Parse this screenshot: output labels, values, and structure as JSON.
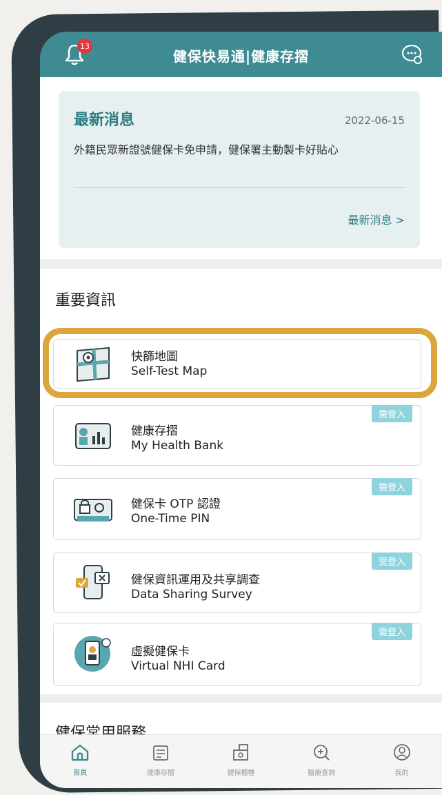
{
  "header": {
    "title": "健保快易通|健康存摺",
    "notification_count": "13",
    "bell_icon": "bell-icon",
    "chat_icon": "chat-bubble-icon"
  },
  "news": {
    "title": "最新消息",
    "date": "2022-06-15",
    "body": "外籍民眾新證號健保卡免申請，健保署主動製卡好貼心",
    "more_link": "最新消息 >"
  },
  "important": {
    "title": "重要資訊",
    "items": [
      {
        "zh": "快篩地圖",
        "en": "Self-Test Map",
        "icon": "map-pin-icon",
        "requires_login": false,
        "login_tag": ""
      },
      {
        "zh": "健康存摺",
        "en": "My Health Bank",
        "icon": "health-bank-icon",
        "requires_login": true,
        "login_tag": "需登入"
      },
      {
        "zh": "健保卡 OTP 認證",
        "en": "One-Time PIN",
        "icon": "otp-lock-icon",
        "requires_login": true,
        "login_tag": "需登入"
      },
      {
        "zh": "健保資訊運用及共享調查",
        "en": "Data Sharing Survey",
        "icon": "phone-survey-icon",
        "requires_login": true,
        "login_tag": "需登入"
      },
      {
        "zh": "虛擬健保卡",
        "en": "Virtual NHI Card",
        "icon": "virtual-card-icon",
        "requires_login": true,
        "login_tag": "需登入"
      }
    ]
  },
  "services": {
    "title": "健保常用服務"
  },
  "bottom_nav": {
    "items": [
      {
        "label": "首頁",
        "icon": "home-icon",
        "active": true
      },
      {
        "label": "健康存摺",
        "icon": "passbook-icon",
        "active": false
      },
      {
        "label": "健保櫃檯",
        "icon": "counter-icon",
        "active": false
      },
      {
        "label": "醫療查詢",
        "icon": "medical-search-icon",
        "active": false
      },
      {
        "label": "我的",
        "icon": "profile-icon",
        "active": false
      }
    ]
  },
  "colors": {
    "brand": "#3f8b93",
    "highlight": "#dba63c",
    "login_tag": "#8fd3dc",
    "badge": "#e2383a"
  }
}
